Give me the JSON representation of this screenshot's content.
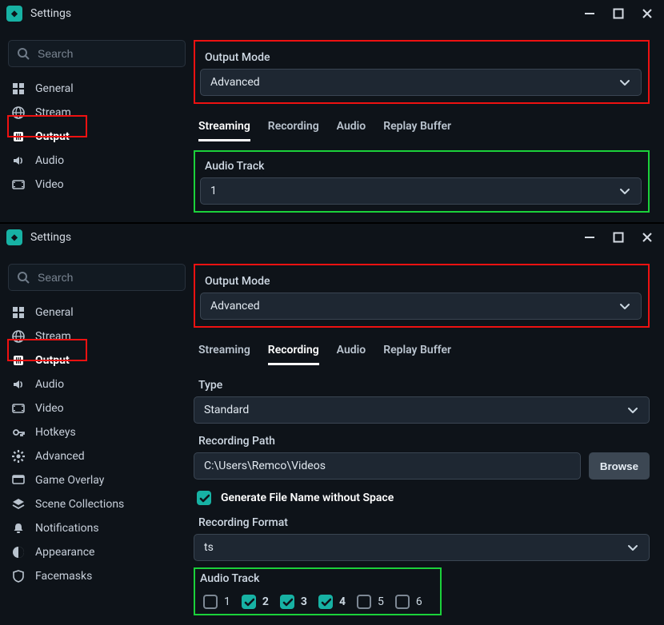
{
  "shared": {
    "window_title": "Settings",
    "search_placeholder": "Search",
    "output_mode_label": "Output Mode",
    "output_mode_value": "Advanced",
    "tabs": {
      "streaming": "Streaming",
      "recording": "Recording",
      "audio": "Audio",
      "replay": "Replay Buffer"
    },
    "browse": "Browse"
  },
  "pane1": {
    "sidebar": {
      "items": [
        {
          "label": "General"
        },
        {
          "label": "Stream"
        },
        {
          "label": "Output"
        },
        {
          "label": "Audio"
        },
        {
          "label": "Video"
        }
      ]
    },
    "audio_track_label": "Audio Track",
    "audio_track_value": "1"
  },
  "pane2": {
    "sidebar": {
      "items": [
        {
          "label": "General"
        },
        {
          "label": "Stream"
        },
        {
          "label": "Output"
        },
        {
          "label": "Audio"
        },
        {
          "label": "Video"
        },
        {
          "label": "Hotkeys"
        },
        {
          "label": "Advanced"
        },
        {
          "label": "Game Overlay"
        },
        {
          "label": "Scene Collections"
        },
        {
          "label": "Notifications"
        },
        {
          "label": "Appearance"
        },
        {
          "label": "Facemasks"
        }
      ]
    },
    "type_label": "Type",
    "type_value": "Standard",
    "recording_path_label": "Recording Path",
    "recording_path_value": "C:\\Users\\Remco\\Videos",
    "gen_filename_label": "Generate File Name without Space",
    "recording_format_label": "Recording Format",
    "recording_format_value": "ts",
    "audio_track_label": "Audio Track",
    "tracks": [
      {
        "n": "1",
        "checked": false
      },
      {
        "n": "2",
        "checked": true
      },
      {
        "n": "3",
        "checked": true
      },
      {
        "n": "4",
        "checked": true
      },
      {
        "n": "5",
        "checked": false
      },
      {
        "n": "6",
        "checked": false
      }
    ]
  }
}
